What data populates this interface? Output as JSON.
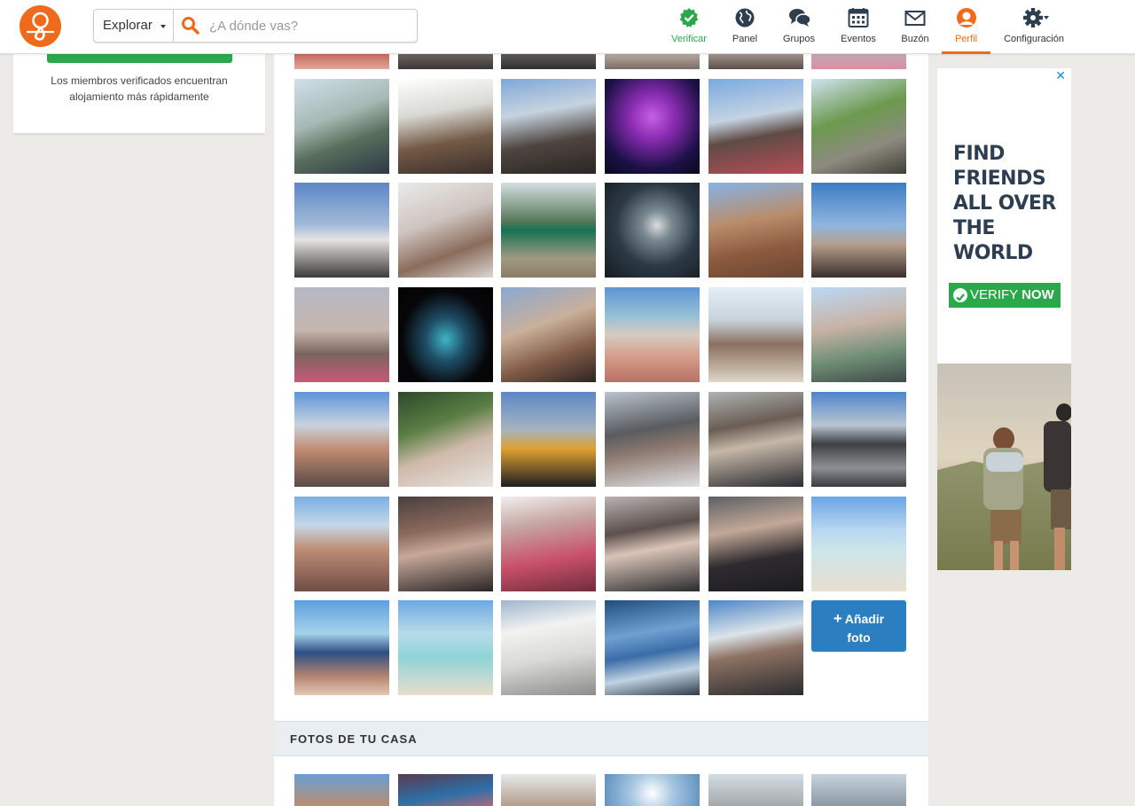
{
  "header": {
    "explore_label": "Explorar",
    "search_placeholder": "¿A dónde vas?",
    "nav": [
      {
        "label": "Verificar",
        "icon": "verified-check-icon"
      },
      {
        "label": "Panel",
        "icon": "globe-icon"
      },
      {
        "label": "Grupos",
        "icon": "chat-bubbles-icon"
      },
      {
        "label": "Eventos",
        "icon": "calendar-icon"
      },
      {
        "label": "Buzón",
        "icon": "envelope-icon"
      },
      {
        "label": "Perfil",
        "icon": "user-icon"
      },
      {
        "label": "Configuración",
        "icon": "gear-icon"
      }
    ]
  },
  "sidebar": {
    "verify_note": "Los miembros verificados encuentran alojamiento más rápidamente"
  },
  "gallery": {
    "add_photo_line1": "Añadir",
    "add_photo_line2": "foto",
    "home_section_title": "FOTOS DE TU CASA"
  },
  "ad": {
    "headline": "FIND FRIENDS ALL OVER THE WORLD",
    "cta_prefix": "VERIFY",
    "cta_bold": "NOW",
    "close_icon": "close-icon"
  },
  "colors": {
    "brand_orange": "#ef6b1b",
    "verify_green": "#2aa84a",
    "button_blue": "#2b7fc0",
    "ad_text": "#2d3e50"
  }
}
